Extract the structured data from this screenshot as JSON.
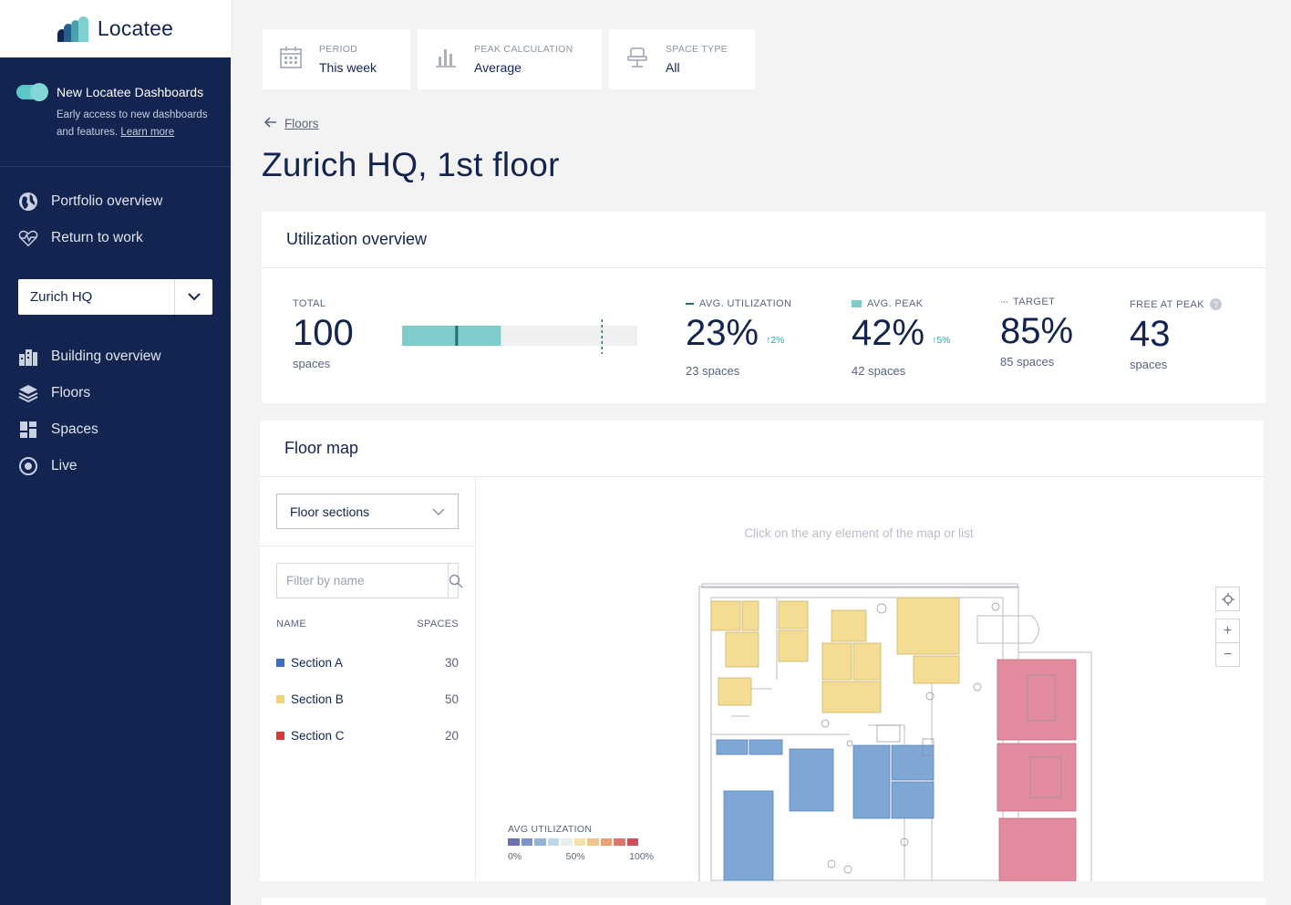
{
  "brand": {
    "name": "Locatee"
  },
  "beta": {
    "title": "New Locatee Dashboards",
    "desc": "Early access to new dashboards and features.",
    "link": "Learn more"
  },
  "nav_top": [
    {
      "label": "Portfolio overview",
      "icon": "globe-icon"
    },
    {
      "label": "Return to work",
      "icon": "heart-pulse-icon"
    }
  ],
  "building_select": {
    "value": "Zurich HQ"
  },
  "nav_bottom": [
    {
      "label": "Building overview",
      "icon": "building-icon"
    },
    {
      "label": "Floors",
      "icon": "layers-icon"
    },
    {
      "label": "Spaces",
      "icon": "grid-icon"
    },
    {
      "label": "Live",
      "icon": "live-icon"
    }
  ],
  "filters": [
    {
      "label": "PERIOD",
      "value": "This week",
      "icon": "calendar-icon"
    },
    {
      "label": "PEAK CALCULATION",
      "value": "Average",
      "icon": "bar-chart-icon"
    },
    {
      "label": "SPACE TYPE",
      "value": "All",
      "icon": "desk-chair-icon"
    }
  ],
  "back_link": "Floors",
  "page_title": "Zurich HQ, 1st floor",
  "utilization": {
    "title": "Utilization overview",
    "total": {
      "label": "TOTAL",
      "value": "100",
      "sub": "spaces"
    },
    "bar": {
      "avg_utilization": 0.23,
      "avg_peak": 0.42,
      "target": 0.85
    },
    "avg_util": {
      "label": "AVG. UTILIZATION",
      "value": "23%",
      "delta": "2%",
      "sub": "23 spaces"
    },
    "avg_peak": {
      "label": "AVG. PEAK",
      "value": "42%",
      "delta": "5%",
      "sub": "42 spaces"
    },
    "target": {
      "label": "TARGET",
      "value": "85%",
      "sub": "85 spaces"
    },
    "free": {
      "label": "FREE AT PEAK",
      "value": "43",
      "sub": "spaces"
    }
  },
  "floor_map": {
    "title": "Floor map",
    "select_value": "Floor sections",
    "search_placeholder": "Filter by name",
    "col_name": "NAME",
    "col_spaces": "SPACES",
    "sections": [
      {
        "name": "Section A",
        "spaces": "30",
        "color": "#3b6fc0"
      },
      {
        "name": "Section B",
        "spaces": "50",
        "color": "#f5d37a"
      },
      {
        "name": "Section C",
        "spaces": "20",
        "color": "#d83a3a"
      }
    ],
    "hint": "Click on the any element of the map or list",
    "legend": {
      "title": "AVG UTILIZATION",
      "ticks": [
        "0%",
        "50%",
        "100%"
      ],
      "colors": [
        "#6b6fb3",
        "#7b93c9",
        "#93b4d9",
        "#bcd8e6",
        "#e6eef0",
        "#f6e2a8",
        "#f3c58c",
        "#ee9f74",
        "#e07466",
        "#d14e5c"
      ]
    },
    "zoom": {
      "locate": "locate-icon",
      "in": "+",
      "out": "−"
    }
  },
  "colors": {
    "sidebar": "#12244f",
    "accent": "#5cc6c9",
    "yellow_room": "#f5dc93",
    "blue_room": "#7ea7d6",
    "red_room": "#e38b9e"
  }
}
